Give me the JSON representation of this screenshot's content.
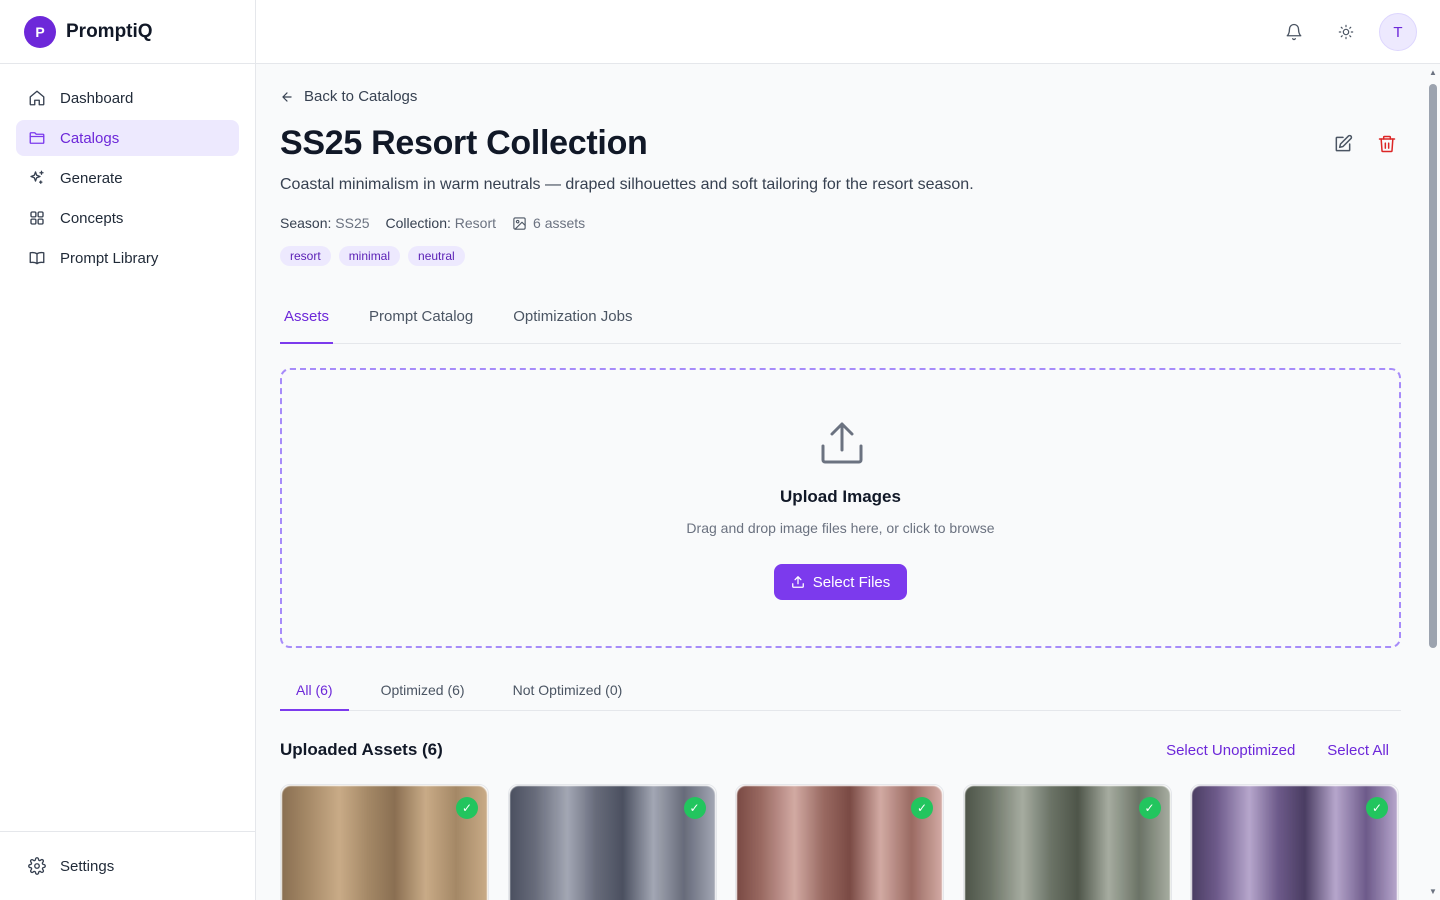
{
  "brand": {
    "logo_letter": "P",
    "name": "PromptiQ"
  },
  "sidebar": {
    "items": [
      {
        "label": "Dashboard",
        "icon": "home-icon"
      },
      {
        "label": "Catalogs",
        "icon": "folder-icon",
        "active": true
      },
      {
        "label": "Generate",
        "icon": "sparkles-icon"
      },
      {
        "label": "Concepts",
        "icon": "grid-icon"
      },
      {
        "label": "Prompt Library",
        "icon": "book-icon"
      }
    ],
    "footer": {
      "label": "Settings",
      "icon": "gear-icon"
    }
  },
  "topbar": {
    "avatar_letter": "T",
    "icons": [
      "bell-icon",
      "sun-icon"
    ]
  },
  "page": {
    "back_label": "Back to Catalogs",
    "title": "SS25 Resort Collection",
    "description": "Coastal minimalism in warm neutrals — draped silhouettes and soft tailoring for the resort season.",
    "meta": {
      "season_label": "Season:",
      "season_value": "SS25",
      "collection_label": "Collection:",
      "collection_value": "Resort",
      "assets_count": "6 assets"
    },
    "tags": [
      "resort",
      "minimal",
      "neutral"
    ]
  },
  "tabs": [
    {
      "label": "Assets",
      "active": true
    },
    {
      "label": "Prompt Catalog"
    },
    {
      "label": "Optimization Jobs"
    }
  ],
  "upload": {
    "title": "Upload Images",
    "subtitle": "Drag and drop image files here, or click to browse",
    "button_label": "Select Files"
  },
  "filter_tabs": [
    {
      "label": "All (6)",
      "active": true
    },
    {
      "label": "Optimized (6)"
    },
    {
      "label": "Not Optimized (0)"
    }
  ],
  "assets": {
    "title": "Uploaded Assets (6)",
    "select_unoptimized": "Select Unoptimized",
    "select_all": "Select All",
    "cards": [
      {
        "check": "✓",
        "colors": [
          "#8a6f52",
          "#c9ab87",
          "#a48866"
        ]
      },
      {
        "check": "✓",
        "colors": [
          "#4b5060",
          "#a3a7b4",
          "#676b7a"
        ]
      },
      {
        "check": "✓",
        "colors": [
          "#7a4a44",
          "#d2aaa3",
          "#9a6a62"
        ]
      },
      {
        "check": "✓",
        "colors": [
          "#4e5549",
          "#a6aca0",
          "#6b7366"
        ]
      },
      {
        "check": "✓",
        "colors": [
          "#4a3d62",
          "#b6a6cc",
          "#6d5a8a"
        ]
      }
    ]
  },
  "colors": {
    "accent": "#7c3aed",
    "accent_soft": "#ede9fe",
    "danger": "#dc2626",
    "success": "#22c55e"
  }
}
